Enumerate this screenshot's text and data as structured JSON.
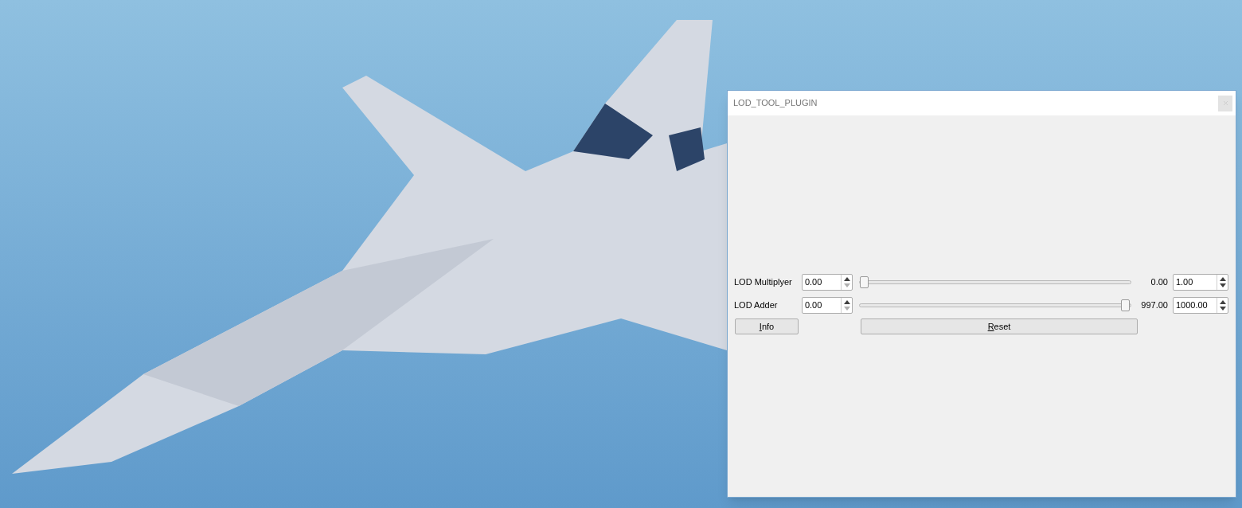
{
  "window": {
    "title": "LOD_TOOL_PLUGIN"
  },
  "rows": [
    {
      "label": "LOD Multiplyer",
      "min_value": "0.00",
      "min_up_disabled": false,
      "min_down_disabled": true,
      "level": 0,
      "reading": "0.00",
      "max_value": "1.00",
      "max_up_disabled": false,
      "max_down_disabled": false
    },
    {
      "label": "LOD Adder",
      "min_value": "0.00",
      "min_up_disabled": false,
      "min_down_disabled": true,
      "level": 0.997,
      "reading": "997.00",
      "max_value": "1000.00",
      "max_up_disabled": false,
      "max_down_disabled": false
    }
  ],
  "buttons": [
    {
      "label": "Info",
      "mnemonic": true,
      "kind": "small"
    },
    {
      "label": "Reset",
      "mnemonic": true,
      "kind": "wide"
    }
  ]
}
